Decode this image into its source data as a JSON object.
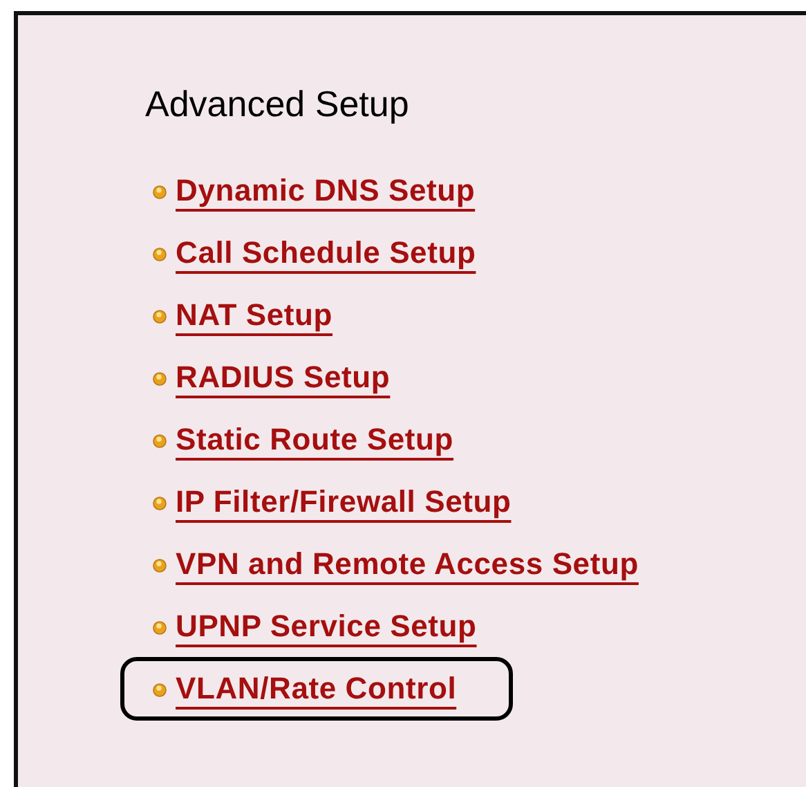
{
  "title": "Advanced Setup",
  "links": [
    {
      "label": "Dynamic DNS Setup",
      "highlighted": false
    },
    {
      "label": "Call Schedule Setup",
      "highlighted": false
    },
    {
      "label": "NAT Setup",
      "highlighted": false
    },
    {
      "label": "RADIUS Setup",
      "highlighted": false
    },
    {
      "label": "Static Route Setup",
      "highlighted": false
    },
    {
      "label": "IP Filter/Firewall Setup",
      "highlighted": false
    },
    {
      "label": "VPN and Remote Access Setup",
      "highlighted": false
    },
    {
      "label": "UPNP Service Setup",
      "highlighted": false
    },
    {
      "label": "VLAN/Rate Control",
      "highlighted": true
    }
  ]
}
